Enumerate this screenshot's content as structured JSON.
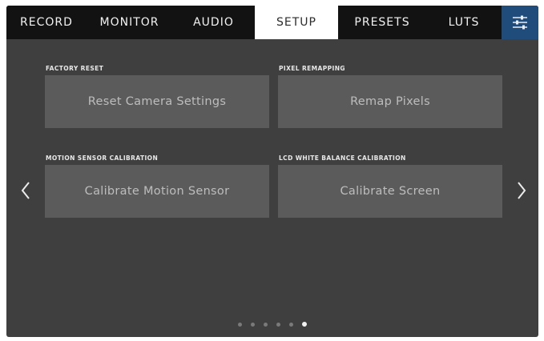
{
  "tabs": [
    {
      "label": "RECORD"
    },
    {
      "label": "MONITOR"
    },
    {
      "label": "AUDIO"
    },
    {
      "label": "SETUP"
    },
    {
      "label": "PRESETS"
    },
    {
      "label": "LUTS"
    }
  ],
  "active_tab": "SETUP",
  "sections": {
    "factory_reset": {
      "label": "FACTORY RESET",
      "button": "Reset Camera Settings"
    },
    "pixel_remapping": {
      "label": "PIXEL REMAPPING",
      "button": "Remap Pixels"
    },
    "motion_sensor": {
      "label": "MOTION SENSOR CALIBRATION",
      "button": "Calibrate Motion Sensor"
    },
    "lcd_white_balance": {
      "label": "LCD WHITE BALANCE CALIBRATION",
      "button": "Calibrate Screen"
    }
  },
  "pagination": {
    "total": 6,
    "current": 6
  },
  "icons": {
    "menu": "sliders-icon",
    "prev": "chevron-left-icon",
    "next": "chevron-right-icon"
  },
  "colors": {
    "tabbar_bg": "#121212",
    "active_tab_bg": "#ffffff",
    "settings_icon_bg": "#1f4c7a",
    "panel_bg": "#3f3f40",
    "button_bg": "#5b5b5c"
  }
}
